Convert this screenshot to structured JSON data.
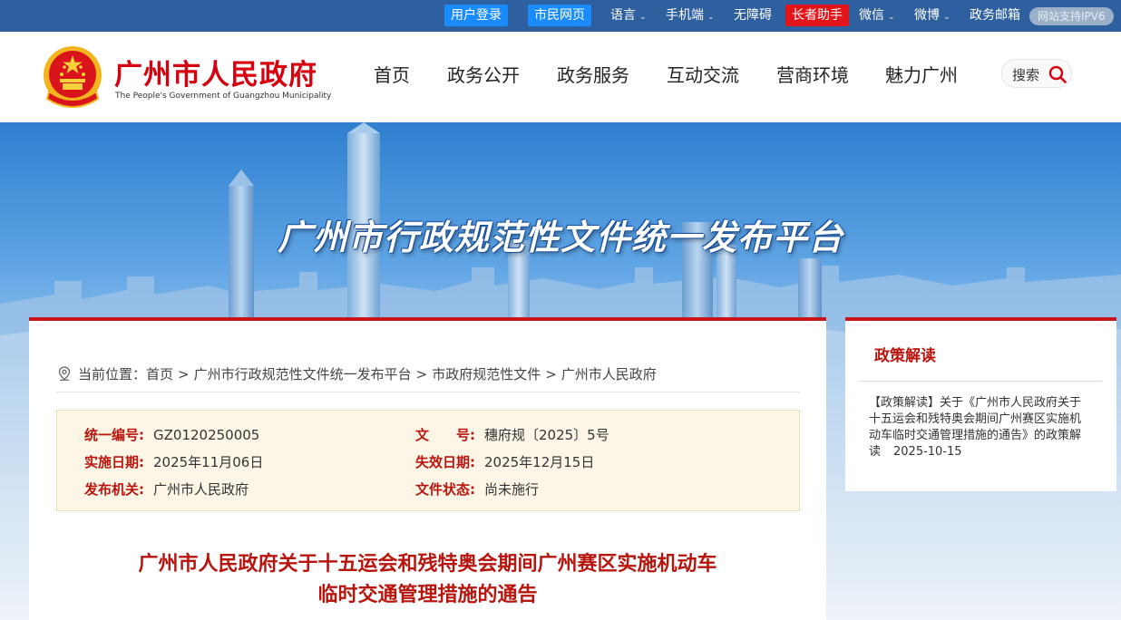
{
  "topbar": {
    "user_login": "用户登录",
    "citizen_page": "市民网页",
    "language": "语言",
    "mobile": "手机端",
    "accessibility": "无障碍",
    "elder_helper": "长者助手",
    "wechat": "微信",
    "weibo": "微博",
    "gov_mail": "政务邮箱",
    "ipv6": "网站支持IPV6"
  },
  "header": {
    "site_title": "广州市人民政府",
    "site_subtitle": "The People's Government of Guangzhou Municipality",
    "nav": [
      "首页",
      "政务公开",
      "政务服务",
      "互动交流",
      "营商环境",
      "魅力广州"
    ],
    "search_label": "搜索"
  },
  "banner": {
    "title": "广州市行政规范性文件统一发布平台"
  },
  "breadcrumb": {
    "prefix": "当前位置：",
    "items": [
      "首页",
      "广州市行政规范性文件统一发布平台",
      "市政府规范性文件",
      "广州市人民政府"
    ],
    "separator": ">"
  },
  "meta": {
    "serial_label": "统一编号:",
    "serial_value": "GZ0120250005",
    "docno_label": "文　　号:",
    "docno_value": "穗府规〔2025〕5号",
    "effective_label": "实施日期:",
    "effective_value": "2025年11月06日",
    "expiry_label": "失效日期:",
    "expiry_value": "2025年12月15日",
    "issuer_label": "发布机关:",
    "issuer_value": "广州市人民政府",
    "status_label": "文件状态:",
    "status_value": "尚未施行"
  },
  "document": {
    "title_line1": "广州市人民政府关于十五运会和残特奥会期间广州赛区实施机动车",
    "title_line2": "临时交通管理措施的通告"
  },
  "side": {
    "title": "政策解读",
    "item_text": "【政策解读】关于《广州市人民政府关于十五运会和残特奥会期间广州赛区实施机动车临时交通管理措施的通告》的政策解读",
    "item_date": "2025-10-15"
  }
}
